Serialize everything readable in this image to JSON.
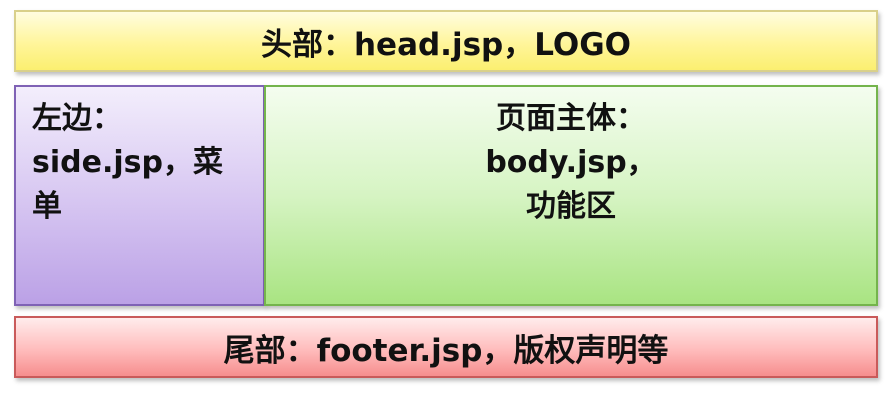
{
  "header": {
    "text": "头部：head.jsp，LOGO"
  },
  "side": {
    "line1": "左边：",
    "line2": "side.jsp，菜",
    "line3": "单"
  },
  "main": {
    "line1": "页面主体：",
    "line2": "body.jsp，",
    "line3": "功能区"
  },
  "footer": {
    "text": "尾部：footer.jsp，版权声明等"
  },
  "colors": {
    "header": "#fff59a",
    "side": "#d8c8f2",
    "main": "#d6f4c3",
    "footer": "#ffbcbc"
  }
}
